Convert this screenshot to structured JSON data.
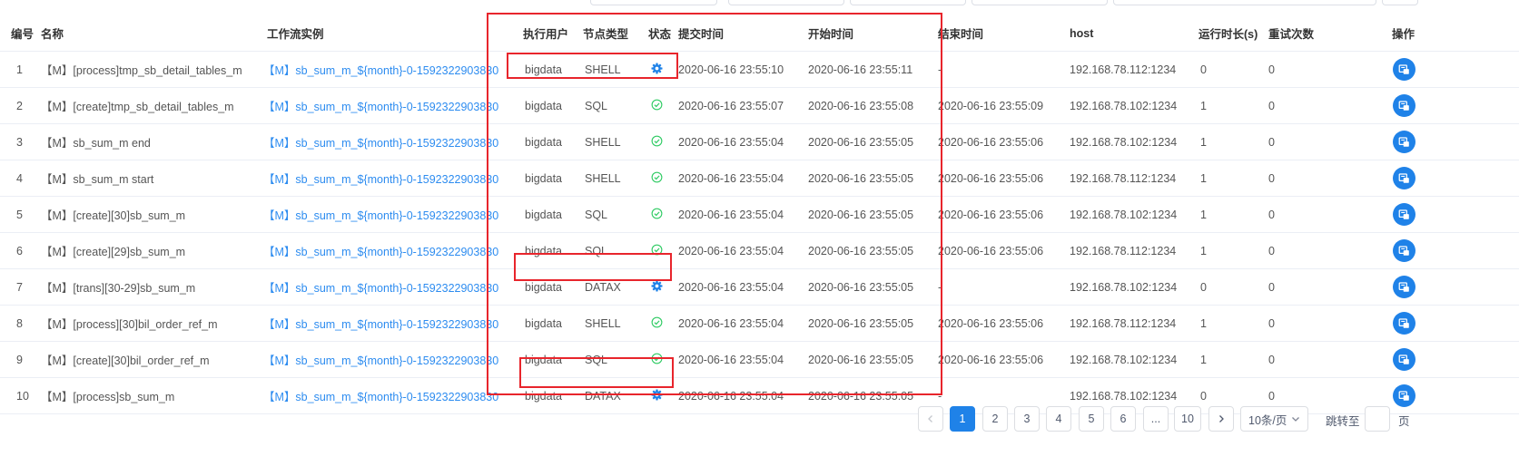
{
  "columns": {
    "idx": "编号",
    "name": "名称",
    "instance": "工作流实例",
    "user": "执行用户",
    "node_type": "节点类型",
    "state": "状态",
    "submit_time": "提交时间",
    "start_time": "开始时间",
    "end_time": "结束时间",
    "host": "host",
    "duration": "运行时长(s)",
    "retry": "重试次数",
    "action": "操作"
  },
  "rows": [
    {
      "idx": "1",
      "name": "【M】[process]tmp_sb_detail_tables_m",
      "instance": "【M】sb_sum_m_${month}-0-1592322903830",
      "user": "bigdata",
      "node_type": "SHELL",
      "state": "running",
      "submit_time": "2020-06-16 23:55:10",
      "start_time": "2020-06-16 23:55:11",
      "end_time": "-",
      "host": "192.168.78.112:1234",
      "duration": "0",
      "retry": "0"
    },
    {
      "idx": "2",
      "name": "【M】[create]tmp_sb_detail_tables_m",
      "instance": "【M】sb_sum_m_${month}-0-1592322903830",
      "user": "bigdata",
      "node_type": "SQL",
      "state": "success",
      "submit_time": "2020-06-16 23:55:07",
      "start_time": "2020-06-16 23:55:08",
      "end_time": "2020-06-16 23:55:09",
      "host": "192.168.78.102:1234",
      "duration": "1",
      "retry": "0"
    },
    {
      "idx": "3",
      "name": "【M】sb_sum_m end",
      "instance": "【M】sb_sum_m_${month}-0-1592322903830",
      "user": "bigdata",
      "node_type": "SHELL",
      "state": "success",
      "submit_time": "2020-06-16 23:55:04",
      "start_time": "2020-06-16 23:55:05",
      "end_time": "2020-06-16 23:55:06",
      "host": "192.168.78.102:1234",
      "duration": "1",
      "retry": "0"
    },
    {
      "idx": "4",
      "name": "【M】sb_sum_m start",
      "instance": "【M】sb_sum_m_${month}-0-1592322903830",
      "user": "bigdata",
      "node_type": "SHELL",
      "state": "success",
      "submit_time": "2020-06-16 23:55:04",
      "start_time": "2020-06-16 23:55:05",
      "end_time": "2020-06-16 23:55:06",
      "host": "192.168.78.112:1234",
      "duration": "1",
      "retry": "0"
    },
    {
      "idx": "5",
      "name": "【M】[create][30]sb_sum_m",
      "instance": "【M】sb_sum_m_${month}-0-1592322903830",
      "user": "bigdata",
      "node_type": "SQL",
      "state": "success",
      "submit_time": "2020-06-16 23:55:04",
      "start_time": "2020-06-16 23:55:05",
      "end_time": "2020-06-16 23:55:06",
      "host": "192.168.78.102:1234",
      "duration": "1",
      "retry": "0"
    },
    {
      "idx": "6",
      "name": "【M】[create][29]sb_sum_m",
      "instance": "【M】sb_sum_m_${month}-0-1592322903830",
      "user": "bigdata",
      "node_type": "SQL",
      "state": "success",
      "submit_time": "2020-06-16 23:55:04",
      "start_time": "2020-06-16 23:55:05",
      "end_time": "2020-06-16 23:55:06",
      "host": "192.168.78.112:1234",
      "duration": "1",
      "retry": "0"
    },
    {
      "idx": "7",
      "name": "【M】[trans][30-29]sb_sum_m",
      "instance": "【M】sb_sum_m_${month}-0-1592322903830",
      "user": "bigdata",
      "node_type": "DATAX",
      "state": "running",
      "submit_time": "2020-06-16 23:55:04",
      "start_time": "2020-06-16 23:55:05",
      "end_time": "-",
      "host": "192.168.78.102:1234",
      "duration": "0",
      "retry": "0"
    },
    {
      "idx": "8",
      "name": "【M】[process][30]bil_order_ref_m",
      "instance": "【M】sb_sum_m_${month}-0-1592322903830",
      "user": "bigdata",
      "node_type": "SHELL",
      "state": "success",
      "submit_time": "2020-06-16 23:55:04",
      "start_time": "2020-06-16 23:55:05",
      "end_time": "2020-06-16 23:55:06",
      "host": "192.168.78.112:1234",
      "duration": "1",
      "retry": "0"
    },
    {
      "idx": "9",
      "name": "【M】[create][30]bil_order_ref_m",
      "instance": "【M】sb_sum_m_${month}-0-1592322903830",
      "user": "bigdata",
      "node_type": "SQL",
      "state": "success",
      "submit_time": "2020-06-16 23:55:04",
      "start_time": "2020-06-16 23:55:05",
      "end_time": "2020-06-16 23:55:06",
      "host": "192.168.78.102:1234",
      "duration": "1",
      "retry": "0"
    },
    {
      "idx": "10",
      "name": "【M】[process]sb_sum_m",
      "instance": "【M】sb_sum_m_${month}-0-1592322903830",
      "user": "bigdata",
      "node_type": "DATAX",
      "state": "running",
      "submit_time": "2020-06-16 23:55:04",
      "start_time": "2020-06-16 23:55:05",
      "end_time": "-",
      "host": "192.168.78.102:1234",
      "duration": "0",
      "retry": "0"
    }
  ],
  "pagination": {
    "pages": [
      "1",
      "2",
      "3",
      "4",
      "5",
      "6",
      "...",
      "10"
    ],
    "active": "1",
    "prev_icon": "chevron-left-icon",
    "next_icon": "chevron-right-icon",
    "page_size": "10条/页",
    "jump_label": "跳转至",
    "page_suffix": "页"
  },
  "icons": {
    "running": "gear-icon",
    "success": "check-circle-icon",
    "action": "view-log-icon"
  },
  "colors": {
    "link": "#2d8cf0",
    "primary": "#1f82e8",
    "success": "#33cc66",
    "running": "#1f82e8",
    "highlight": "#e8252c"
  }
}
